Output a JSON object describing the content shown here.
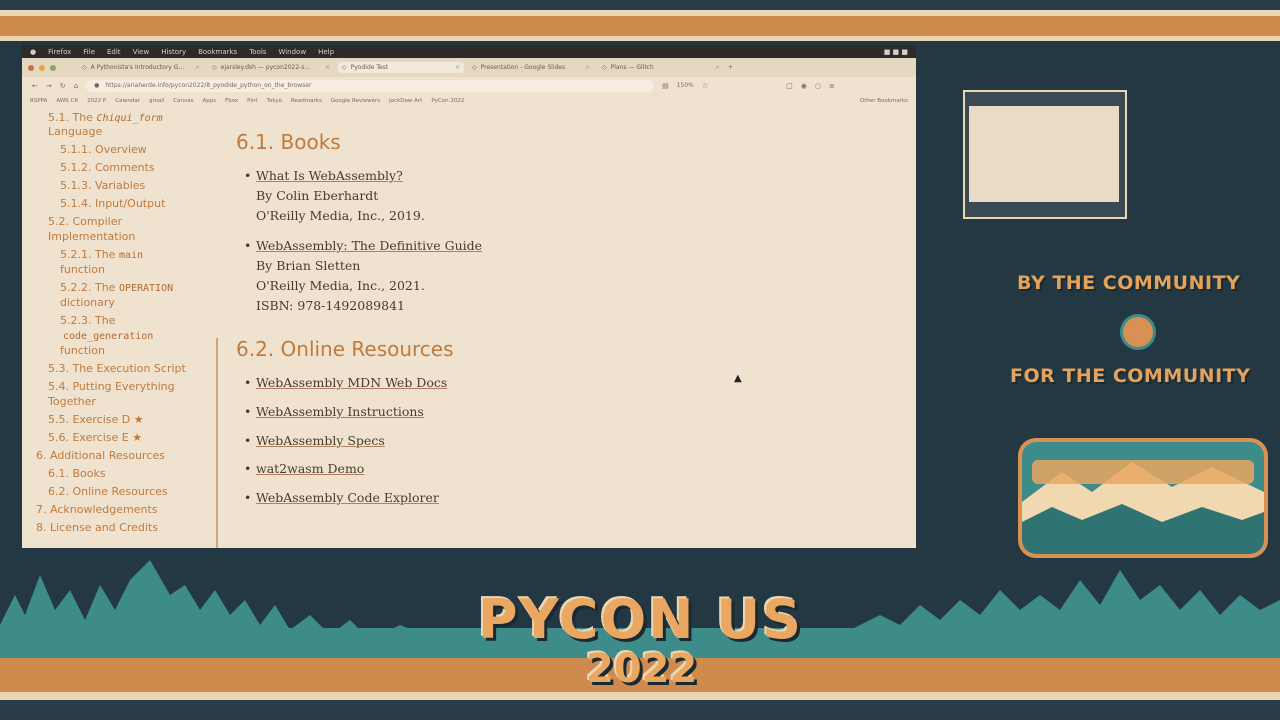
{
  "browser": {
    "menubar": [
      "Firefox",
      "File",
      "Edit",
      "View",
      "History",
      "Bookmarks",
      "Tools",
      "Window",
      "Help"
    ],
    "tabs": [
      {
        "label": "A Pythonista's Introductory G..."
      },
      {
        "label": "ejarsley.dsh — pycon2022-s..."
      },
      {
        "label": "Pyodide Test"
      },
      {
        "label": "Presentation - Google Slides"
      },
      {
        "label": "Plans — Glitch"
      }
    ],
    "url": "https://ariaherde.info/pycon2022/8_pyodide_python_on_the_browser",
    "zoom": "150%",
    "bookmarks": [
      "RSPPA",
      "AWS CR",
      "2022 P",
      "Calendar",
      "gmail",
      "Canvas",
      "Apps",
      "Fbox",
      "Pint",
      "Tokyo",
      "Readmarks",
      "Google Reviewers",
      "JackDaw Art",
      "PyCon 2022"
    ],
    "other_bookmarks": "Other Bookmarks"
  },
  "sidebar": {
    "items": [
      {
        "label": "5.1. The ",
        "code": "",
        "italic": "Chiqui_form",
        "label2": ""
      },
      {
        "label": "Language"
      },
      {
        "label": "5.1.1. Overview"
      },
      {
        "label": "5.1.2. Comments"
      },
      {
        "label": "5.1.3. Variables"
      },
      {
        "label": "5.1.4. Input/Output"
      },
      {
        "label": "5.2. Compiler"
      },
      {
        "label": "Implementation"
      },
      {
        "label": "5.2.1. The ",
        "code": "main"
      },
      {
        "label": "function"
      },
      {
        "label": "5.2.2. The ",
        "code": "OPERATION"
      },
      {
        "label": "dictionary"
      },
      {
        "label": "5.2.3. The"
      },
      {
        "label": "",
        "code": "code_generation"
      },
      {
        "label": "function"
      },
      {
        "label": "5.3. The Execution Script"
      },
      {
        "label": "5.4. Putting Everything"
      },
      {
        "label": "Together"
      },
      {
        "label": "5.5. Exercise D ★"
      },
      {
        "label": "5.6. Exercise E ★"
      },
      {
        "label": "6. Additional Resources"
      },
      {
        "label": "6.1. Books"
      },
      {
        "label": "6.2. Online Resources"
      },
      {
        "label": "7. Acknowledgements"
      },
      {
        "label": "8. License and Credits"
      }
    ]
  },
  "main": {
    "books_heading": "6.1. Books",
    "books": [
      {
        "title": "What Is WebAssembly?",
        "author": "By Colin Eberhardt",
        "publisher": "O'Reilly Media, Inc., 2019."
      },
      {
        "title": "WebAssembly: The Definitive Guide",
        "author": "By Brian Sletten",
        "publisher": "O'Reilly Media, Inc., 2021.",
        "isbn": "ISBN: 978-1492089841"
      }
    ],
    "online_heading": "6.2. Online Resources",
    "online": [
      "WebAssembly MDN Web Docs",
      "WebAssembly Instructions",
      "WebAssembly Specs",
      "wat2wasm Demo",
      "WebAssembly Code Explorer"
    ]
  },
  "conference": {
    "tagline_1": "BY THE COMMUNITY",
    "tagline_2": "FOR THE COMMUNITY",
    "logo_line_1": "PYCON US",
    "logo_line_2": "2022"
  },
  "colors": {
    "accent": "#c07a3c",
    "teal": "#3d8c8a",
    "sand": "#e9d7b4"
  }
}
